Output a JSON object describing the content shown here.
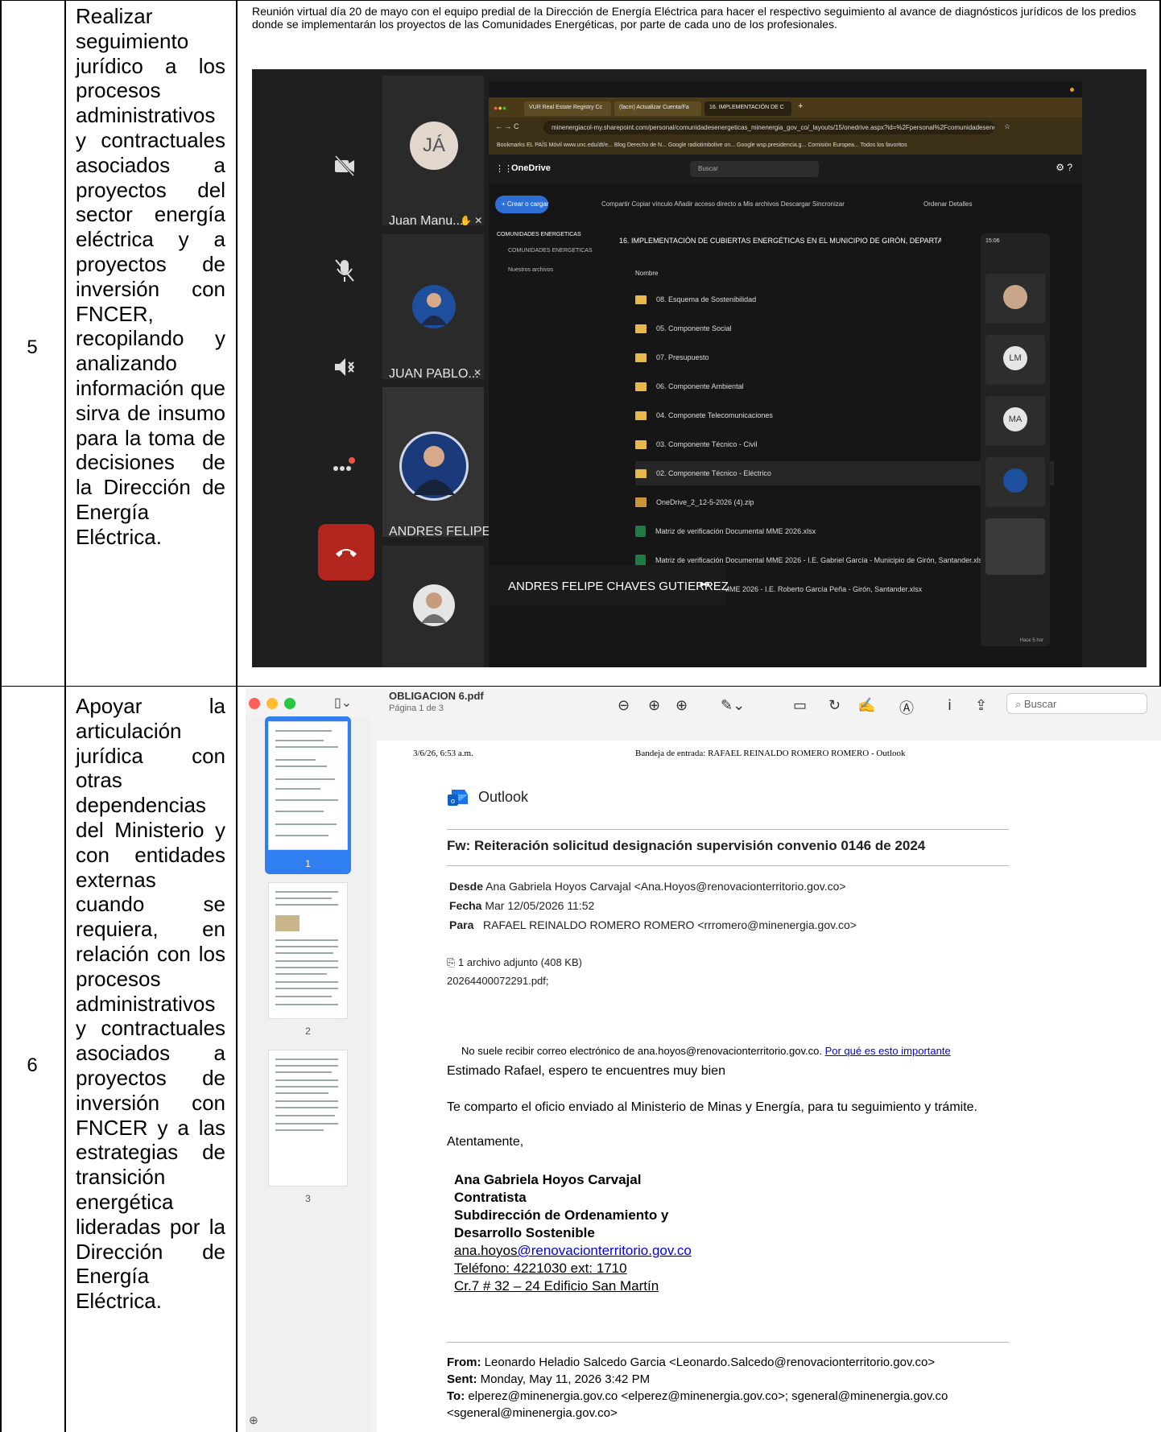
{
  "rows": [
    {
      "number": "5",
      "description": "Realizar seguimiento jurídico a los procesos administrativos y contractuales asociados a proyectos del sector energía eléctrica y a proyectos de inversión con FNCER, recopilando y analizando información que sirva de insumo para la toma de decisiones de la Dirección de Energía Eléctrica.",
      "evidence_text": "Reunión virtual día 20 de mayo con el equipo predial de la Dirección de Energía Eléctrica para hacer el respectivo seguimiento al avance de diagnósticos jurídicos de los predios donde se implementarán los proyectos de las Comunidades Energéticas, por parte de cada uno de los profesionales."
    },
    {
      "number": "6",
      "description": "Apoyar la articulación jurídica con otras dependencias del Ministerio y con entidades externas cuando se requiera, en relación con los procesos administrativos y contractuales asociados a proyectos de inversión con FNCER y a las estrategias de transición energética lideradas por la Dirección de Energía Eléctrica."
    }
  ],
  "meeting": {
    "participants": [
      {
        "initials": "JÁ",
        "name": "Juan Manu..."
      },
      {
        "name": "JUAN PABLO..."
      },
      {
        "name": "ANDRES FELIPE..."
      }
    ],
    "speaker_name": "ANDRES FELIPE CHAVES GUTIERREZ",
    "speaker_more": "•••",
    "browser": {
      "tabs": [
        "VUR Real Estate Registry Cc",
        "(facm) Actualizar Cuenta/Fa",
        "16. IMPLEMENTACIÓN DE C"
      ],
      "url": "minenergiacol-my.sharepoint.com/personal/comunidadesenergeticas_minenergia_gov_co/_layouts/15/onedrive.aspx?id=%2Fpersonal%2Fcomunidadesenerg...",
      "bookmarks": "Bookmarks   EL PAÍS Móvil   www.unc.edu/dt/e...   Blog Derecho de N...   Google   radiotimbolive on...   Google   wsp.presidencia.g...   Comisión Europea...   Todos los favoritos",
      "app_name": "OneDrive",
      "search_placeholder": "Buscar",
      "create_button": "+ Crear o cargar",
      "toolbar": "Compartir   Copiar vínculo   Añadir acceso directo a Mis archivos   Descargar   Sincronizar",
      "toolbar_right": "Ordenar   Detalles",
      "nav_items": [
        "COMUNIDADES ENERGETICAS",
        "COMUNIDADES ENERGETICAS",
        "Nuestros archivos"
      ],
      "breadcrumb": "16. IMPLEMENTACIÓN DE CUBIERTAS ENERGÉTICAS EN EL MUNICIPIO DE GIRÓN, DEPARTAMENTO DE SANT",
      "column_header": "Nombre",
      "items": [
        {
          "kind": "folder",
          "name": "08. Esquema de Sostenibilidad"
        },
        {
          "kind": "folder",
          "name": "05. Componente Social"
        },
        {
          "kind": "folder",
          "name": "07. Presupuesto"
        },
        {
          "kind": "folder",
          "name": "06. Componente Ambiental"
        },
        {
          "kind": "folder",
          "name": "04. Componete Telecomunicaciones"
        },
        {
          "kind": "folder",
          "name": "03. Componente Técnico - Civil"
        },
        {
          "kind": "folder",
          "name": "02. Componente Técnico - Eléctrico"
        },
        {
          "kind": "zip",
          "name": "OneDrive_2_12-5-2026 (4).zip"
        },
        {
          "kind": "xlsx",
          "name": "Matriz de verificación Documental MME 2026.xlsx"
        },
        {
          "kind": "xlsx",
          "name": "Matriz de verificación Documental MME 2026 - I.E. Gabriel García - Municipio de Girón, Santander.xlsx"
        },
        {
          "kind": "xlsx",
          "name": "...ental MME 2026 - I.E. Roberto García Peña - Girón, Santander.xlsx"
        }
      ]
    },
    "side_panel": {
      "time": "15:06",
      "avatars": [
        "LM",
        "MA"
      ],
      "footer": "Hace 5 hor"
    }
  },
  "pdf": {
    "filename": "OBLIGACION 6.pdf",
    "page_info": "Página 1 de 3",
    "search_placeholder": "Buscar",
    "thumb_numbers": [
      "1",
      "2",
      "3"
    ],
    "header_left": "3/6/26, 6:53 a.m.",
    "header_center": "Bandeja de entrada: RAFAEL REINALDO ROMERO ROMERO - Outlook",
    "app": "Outlook",
    "subject": "Fw: Reiteración solicitud designación supervisión convenio 0146 de 2024",
    "from_label": "Desde",
    "from": "Ana Gabriela Hoyos Carvajal <Ana.Hoyos@renovacionterritorio.gov.co>",
    "date_label": "Fecha",
    "date": "Mar 12/05/2026 11:52",
    "to_label": "Para",
    "to": "RAFAEL REINALDO ROMERO ROMERO <rrromero@minenergia.gov.co>",
    "attachment_count": "1 archivo adjunto (408 KB)",
    "attachment_name": "20264400072291.pdf;",
    "warning": "No suele recibir correo electrónico de ana.hoyos@renovacionterritorio.gov.co.",
    "warning_link": "Por qué es esto importante",
    "greeting": "Estimado Rafael, espero te encuentres muy bien",
    "body": "Te comparto el oficio enviado al Ministerio de Minas y Energía, para tu seguimiento y trámite.",
    "closing": "Atentamente,",
    "sig_name": "Ana Gabriela Hoyos Carvajal",
    "sig_role": "Contratista",
    "sig_dept1": "Subdirección de Ordenamiento y",
    "sig_dept2": "Desarrollo Sostenible",
    "sig_email_user": "ana.hoyos",
    "sig_email_domain": "@renovacionterritorio.gov.co",
    "sig_phone": "Teléfono: 4221030 ext: 1710",
    "sig_address": "Cr.7 # 32 – 24 Edificio San Martín",
    "fwd_from_label": "From:",
    "fwd_from": "Leonardo Heladio Salcedo Garcia <Leonardo.Salcedo@renovacionterritorio.gov.co>",
    "fwd_sent_label": "Sent:",
    "fwd_sent": "Monday, May 11, 2026 3:42 PM",
    "fwd_to_label": "To:",
    "fwd_to": "elperez@minenergia.gov.co <elperez@minenergia.gov.co>; sgeneral@minenergia.gov.co",
    "fwd_to2": "<sgeneral@minenergia.gov.co>"
  }
}
